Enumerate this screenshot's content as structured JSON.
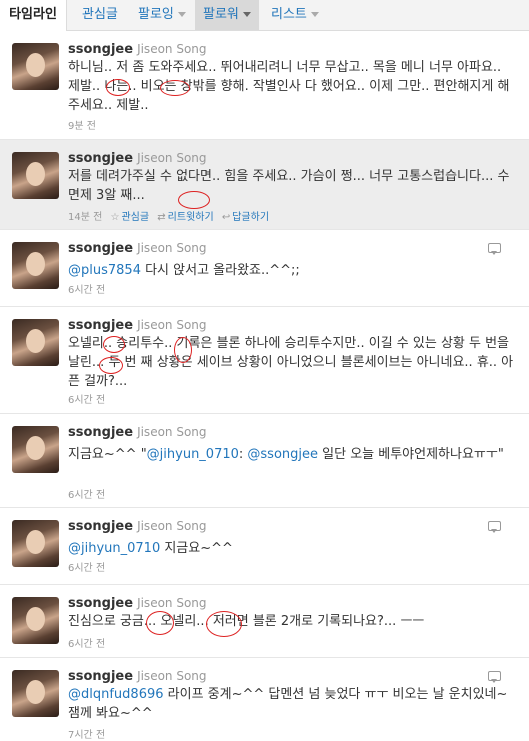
{
  "tabs": [
    {
      "label": "타임라인"
    },
    {
      "label": "관심글"
    },
    {
      "label": "팔로잉"
    },
    {
      "label": "팔로워"
    },
    {
      "label": "리스트"
    }
  ],
  "tweets": [
    {
      "username": "ssongjee",
      "fullname": "Jiseon Song",
      "text": "하니님.. 저 좀 도와주세요.. 뛰어내리려니 너무 무삽고.. 목을 메니 너무 아파요.. 제발.. 나는.. 비오는 창밖를 향해. 작별인사 다 했어요.. 이제 그만.. 편안해지게 해주세요.. 제발..",
      "time": "9분 전"
    },
    {
      "username": "ssongjee",
      "fullname": "Jiseon Song",
      "text": "저를 데려가주실 수 없다면.. 힘을 주세요.. 가슴이 쩡... 너무 고통스럽습니다... 수면제 3알 째...",
      "time": "14분 전",
      "action_fav": "관심글",
      "action_rt": "리트윗하기",
      "action_reply": "답글하기"
    },
    {
      "username": "ssongjee",
      "fullname": "Jiseon Song",
      "mention": "@plus7854",
      "text": " 다시 앉서고 올라왔죠..^^;;",
      "time": "6시간 전"
    },
    {
      "username": "ssongjee",
      "fullname": "Jiseon Song",
      "text": "오넬리.. 승리투수.. 기록은 블론 하나에 승리투수지만.. 이길 수 있는 상황 두 번을 날린... 두 번 째 상황은 세이브 상황이 아니었으니 블론세이브는 아니네요.. 휴.. 아픈 걸까?...",
      "time": "6시간 전"
    },
    {
      "username": "ssongjee",
      "fullname": "Jiseon Song",
      "text_a": "지금요~^^ \"",
      "mention_a": "@jihyun_0710",
      "text_b": ": ",
      "mention_b": "@ssongjee",
      "text_c": " 일단 오늘 베투야언제하나요ㅠㅜ\"",
      "time": "6시간 전"
    },
    {
      "username": "ssongjee",
      "fullname": "Jiseon Song",
      "mention": "@jihyun_0710",
      "text": " 지금요~^^",
      "time": "6시간 전"
    },
    {
      "username": "ssongjee",
      "fullname": "Jiseon Song",
      "text": "진심으로 궁금... 오넬리... 저러면 블론 2개로 기록되나요?... ㅡㅡ",
      "time": "6시간 전"
    },
    {
      "username": "ssongjee",
      "fullname": "Jiseon Song",
      "mention": "@dlqnfud8696",
      "text": " 라이프 중계~^^ 답멘션 넘 늦었다 ㅠㅜ 비오는 날 운치있네~ 잼께 봐요~^^",
      "time": "7시간 전"
    }
  ]
}
